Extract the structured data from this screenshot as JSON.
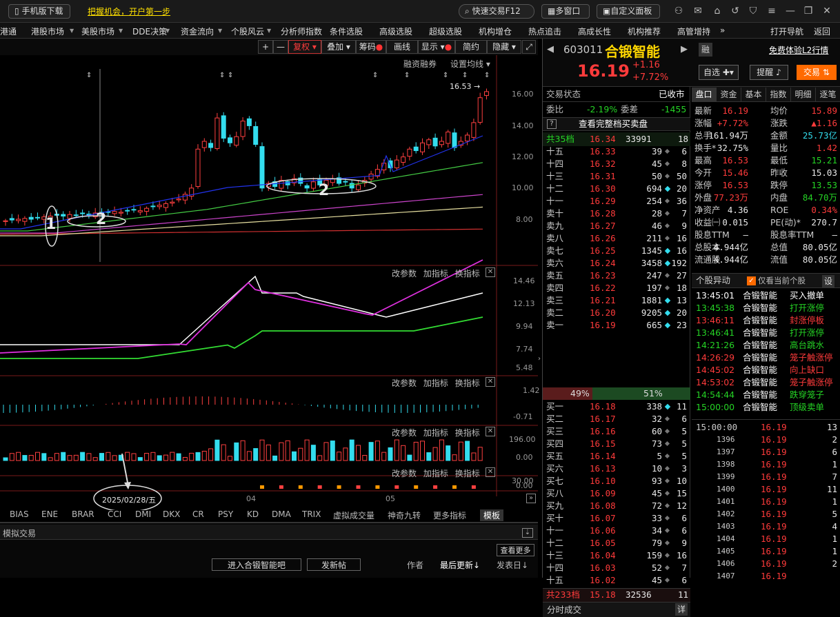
{
  "topbar": {
    "mobile": "手机版下载",
    "promo": "把握机会，开户第一步",
    "quick_trade": "快速交易F12",
    "multi_window": "多窗口",
    "custom_panel": "自定义面板"
  },
  "menu": [
    "港通",
    "港股市场",
    "美股市场",
    "DDE决策",
    "资金流向",
    "个股风云",
    "分析师指数",
    "条件选股",
    "高级选股",
    "超级选股",
    "机构增仓",
    "热点追击",
    "高成长性",
    "机构推荐",
    "高管增持",
    "打开导航",
    "返回"
  ],
  "chart_toolbar": {
    "plus": "+",
    "minus": "—",
    "fuquan": "复权",
    "overlay": "叠加",
    "chips": "筹码",
    "draw": "画线",
    "display": "显示",
    "simple": "简约",
    "hide": "隐藏"
  },
  "chart_sub": {
    "margin": "融资融券",
    "set_ma": "设置均线",
    "last_label": "16.53"
  },
  "main_axis": [
    "16.00",
    "14.00",
    "12.00",
    "10.00",
    "8.00"
  ],
  "ind1": {
    "axis": [
      "14.46",
      "12.13",
      "9.94",
      "7.74",
      "5.48"
    ]
  },
  "ind2": {
    "axis": [
      "1.42",
      "-0.71"
    ]
  },
  "ind3": {
    "axis": [
      "196.00",
      "0.00"
    ]
  },
  "ind4": {
    "axis": [
      "30.00",
      "0.00"
    ]
  },
  "ind_btns": {
    "params": "改参数",
    "add": "加指标",
    "switch": "换指标"
  },
  "annot": {
    "n1": "1",
    "n2a": "2",
    "n2b": "2",
    "date": "2025/02/28/五",
    "m04": "04",
    "m05": "05"
  },
  "bottom_tabs": [
    "BIAS",
    "ENE",
    "BRAR",
    "CCI",
    "DMI",
    "DKX",
    "CR",
    "PSY",
    "KD",
    "DMA",
    "TRIX",
    "虚拟成交量",
    "神奇九转",
    "更多指标",
    "模板"
  ],
  "bottom": {
    "sim": "模拟交易",
    "more": "查看更多",
    "enter": "进入合锻智能吧",
    "post": "发新帖",
    "author": "作者",
    "latest": "最后更新↓",
    "publish": "发表日↓"
  },
  "stock": {
    "code": "603011",
    "name": "合锻智能",
    "price": "16.19",
    "change": "+1.16",
    "pct": "+7.72%",
    "rong": "融",
    "l2": "免费体验L2行情",
    "zixuan": "自选",
    "remind": "提醒",
    "trade": "交易"
  },
  "order": {
    "status_label": "交易状态",
    "status": "已收市",
    "weibi_label": "委比",
    "weibi": "-2.19%",
    "weicha_label": "委差",
    "weicha": "-1455",
    "full_view": "查看完整档买卖盘",
    "q": "?",
    "total_sell_label": "共35档",
    "total_sell_price": "16.34",
    "total_sell_vol": "33991",
    "total_sell_n": "18",
    "sells": [
      [
        "十五",
        "16.33",
        "39",
        "6"
      ],
      [
        "十四",
        "16.32",
        "45",
        "8"
      ],
      [
        "十三",
        "16.31",
        "50",
        "50"
      ],
      [
        "十二",
        "16.30",
        "694",
        "20"
      ],
      [
        "十一",
        "16.29",
        "254",
        "36"
      ],
      [
        "卖十",
        "16.28",
        "28",
        "7"
      ],
      [
        "卖九",
        "16.27",
        "46",
        "9"
      ],
      [
        "卖八",
        "16.26",
        "211",
        "16"
      ],
      [
        "卖七",
        "16.25",
        "1345",
        "16"
      ],
      [
        "卖六",
        "16.24",
        "3458",
        "192"
      ],
      [
        "卖五",
        "16.23",
        "247",
        "27"
      ],
      [
        "卖四",
        "16.22",
        "197",
        "18"
      ],
      [
        "卖三",
        "16.21",
        "1881",
        "13"
      ],
      [
        "卖二",
        "16.20",
        "9205",
        "20"
      ],
      [
        "卖一",
        "16.19",
        "665",
        "23"
      ]
    ],
    "ratio_sell": "49%",
    "ratio_buy": "51%",
    "buys": [
      [
        "买一",
        "16.18",
        "338",
        "11"
      ],
      [
        "买二",
        "16.17",
        "32",
        "6"
      ],
      [
        "买三",
        "16.16",
        "60",
        "5"
      ],
      [
        "买四",
        "16.15",
        "73",
        "5"
      ],
      [
        "买五",
        "16.14",
        "5",
        "5"
      ],
      [
        "买六",
        "16.13",
        "10",
        "3"
      ],
      [
        "买七",
        "16.10",
        "93",
        "10"
      ],
      [
        "买八",
        "16.09",
        "45",
        "15"
      ],
      [
        "买九",
        "16.08",
        "72",
        "12"
      ],
      [
        "买十",
        "16.07",
        "33",
        "6"
      ],
      [
        "十一",
        "16.06",
        "34",
        "6"
      ],
      [
        "十二",
        "16.05",
        "79",
        "9"
      ],
      [
        "十三",
        "16.04",
        "159",
        "16"
      ],
      [
        "十四",
        "16.03",
        "52",
        "7"
      ],
      [
        "十五",
        "16.02",
        "45",
        "6"
      ]
    ],
    "total_buy_label": "共233档",
    "total_buy_price": "15.18",
    "total_buy_vol": "32536",
    "total_buy_n": "11",
    "fenshi": "分时成交",
    "detail": "详"
  },
  "tabs": [
    "盘口",
    "资金",
    "基本",
    "指数",
    "明细",
    "逐笔"
  ],
  "quote": [
    [
      "最新",
      "16.19",
      "均价",
      "15.89"
    ],
    [
      "涨幅",
      "+7.72%",
      "涨跌",
      "▲1.16"
    ],
    [
      "总手",
      "161.94万",
      "金额",
      "25.73亿"
    ],
    [
      "换手*",
      "32.75%",
      "量比",
      "1.42"
    ],
    [
      "最高",
      "16.53",
      "最低",
      "15.21"
    ],
    [
      "今开",
      "15.46",
      "昨收",
      "15.03"
    ],
    [
      "涨停",
      "16.53",
      "跌停",
      "13.53"
    ],
    [
      "外盘",
      "77.23万",
      "内盘",
      "84.70万"
    ],
    [
      "净资产",
      "4.36",
      "ROE",
      "0.34%"
    ],
    [
      "收益㈠",
      "0.015",
      "PE(动)*",
      "270.7"
    ],
    [
      "股息TTM",
      "—",
      "股息率TTM",
      "—"
    ],
    [
      "总股本",
      "4.944亿",
      "总值",
      "80.05亿"
    ],
    [
      "流通股",
      "4.944亿",
      "流值",
      "80.05亿"
    ]
  ],
  "anomaly": {
    "title": "个股异动",
    "only": "仅看当前个股",
    "set": "设",
    "rows": [
      [
        "13:45:01",
        "合锻智能",
        "买入撤单"
      ],
      [
        "13:45:38",
        "合锻智能",
        "打开涨停"
      ],
      [
        "13:46:11",
        "合锻智能",
        "封涨停板"
      ],
      [
        "13:46:41",
        "合锻智能",
        "打开涨停"
      ],
      [
        "14:21:26",
        "合锻智能",
        "高台跳水"
      ],
      [
        "14:26:29",
        "合锻智能",
        "笼子触涨停"
      ],
      [
        "14:45:02",
        "合锻智能",
        "向上缺口"
      ],
      [
        "14:53:02",
        "合锻智能",
        "笼子触涨停"
      ],
      [
        "14:54:44",
        "合锻智能",
        "跌穿笼子"
      ],
      [
        "15:00:00",
        "合锻智能",
        "顶级卖单"
      ]
    ]
  },
  "ticks": [
    [
      "15:00:00",
      "16.19",
      "13"
    ],
    [
      "1396",
      "16.19",
      "2"
    ],
    [
      "1397",
      "16.19",
      "6"
    ],
    [
      "1398",
      "16.19",
      "1"
    ],
    [
      "1399",
      "16.19",
      "7"
    ],
    [
      "1400",
      "16.19",
      "11"
    ],
    [
      "1401",
      "16.19",
      "1"
    ],
    [
      "1402",
      "16.19",
      "5"
    ],
    [
      "1403",
      "16.19",
      "4"
    ],
    [
      "1404",
      "16.19",
      "1"
    ],
    [
      "1405",
      "16.19",
      "1"
    ],
    [
      "1406",
      "16.19",
      "2"
    ],
    [
      "1407",
      "16.19",
      ""
    ]
  ]
}
